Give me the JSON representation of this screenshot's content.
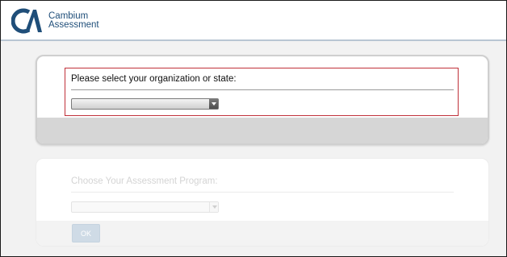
{
  "header": {
    "logo_line1": "Cambium",
    "logo_line2": "Assessment",
    "logo_icon": "cambium-ca-logo",
    "brand_color": "#1f4e79"
  },
  "organization_card": {
    "prompt": "Please select your organization or state:",
    "select_value": "",
    "highlight_color": "#c0313a"
  },
  "program_card": {
    "prompt": "Choose Your Assessment Program:",
    "select_value": "",
    "ok_label": "OK",
    "ok_color": "#cfdbe6"
  }
}
